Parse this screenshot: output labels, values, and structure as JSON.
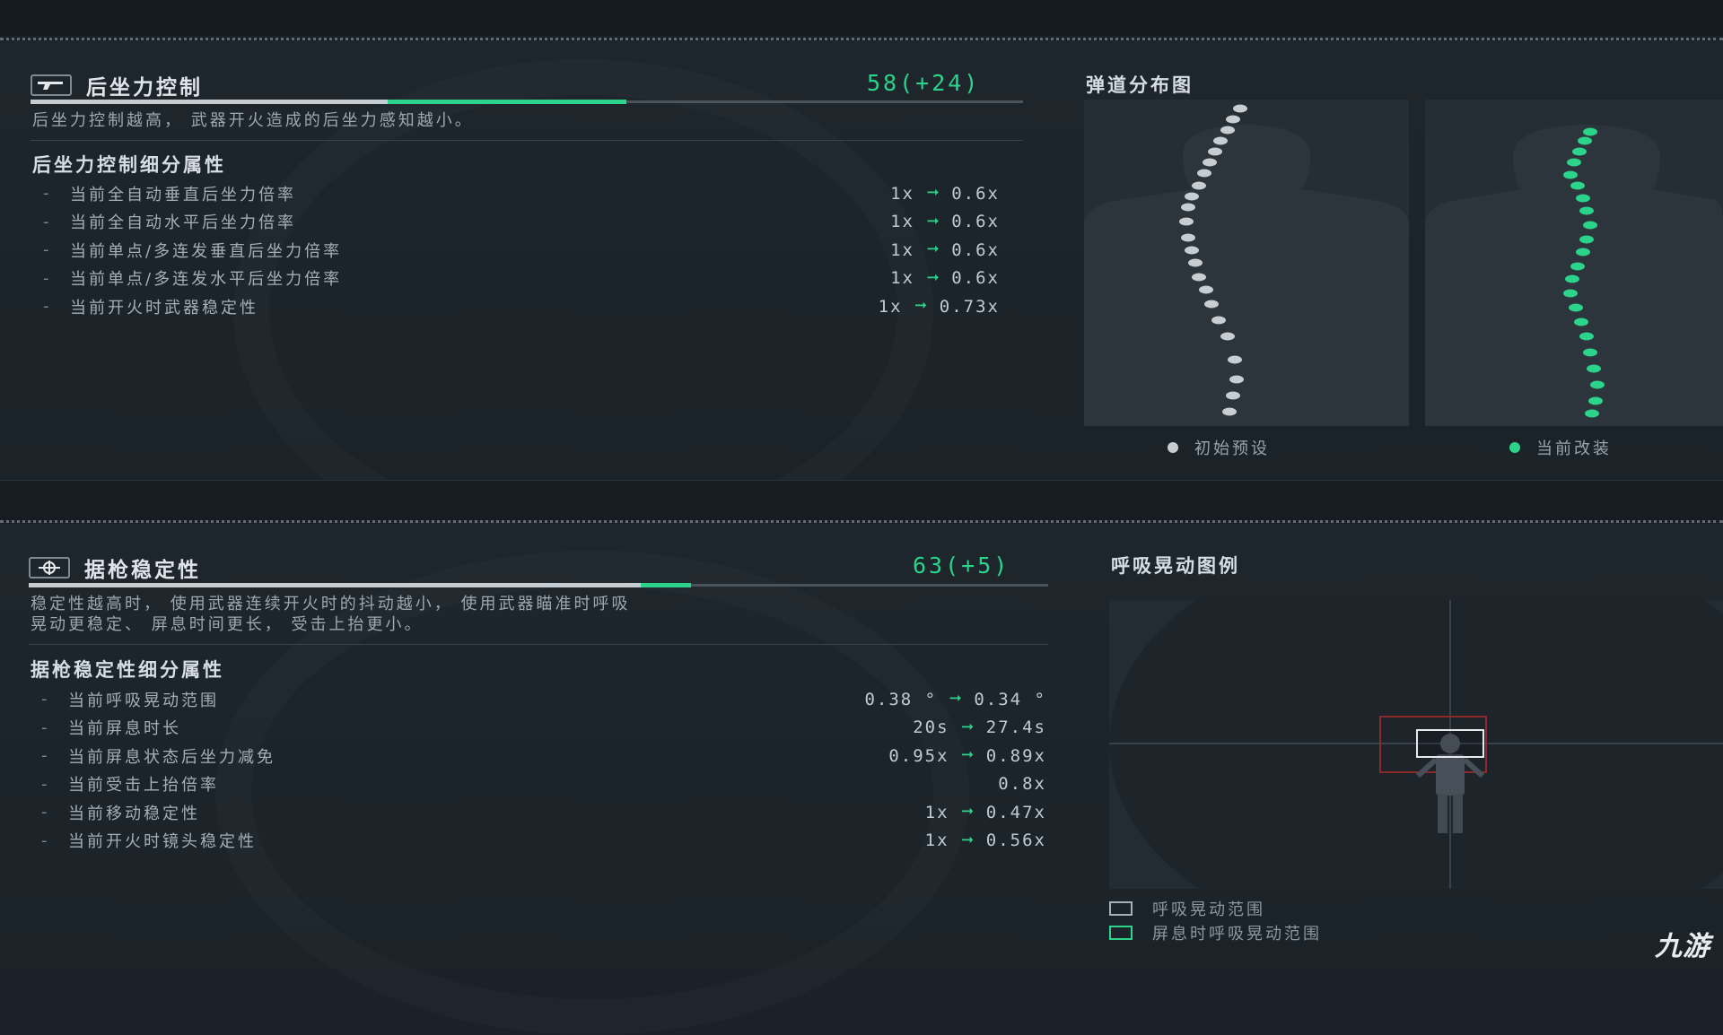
{
  "recoil": {
    "title": "后坐力控制",
    "score": "58(+24)",
    "base_level": 0.36,
    "bonus_level": 0.24,
    "description": "后坐力控制越高， 武器开火造成的后坐力感知越小。",
    "subtitle": "后坐力控制细分属性",
    "rows": [
      {
        "label": "当前全自动垂直后坐力倍率",
        "from": "1x",
        "to": "0.6x"
      },
      {
        "label": "当前全自动水平后坐力倍率",
        "from": "1x",
        "to": "0.6x"
      },
      {
        "label": "当前单点/多连发垂直后坐力倍率",
        "from": "1x",
        "to": "0.6x"
      },
      {
        "label": "当前单点/多连发水平后坐力倍率",
        "from": "1x",
        "to": "0.6x"
      },
      {
        "label": "当前开火时武器稳定性",
        "from": "1x",
        "to": "0.73x"
      }
    ]
  },
  "ballistic": {
    "title": "弹道分布图",
    "legend_default": "初始预设",
    "legend_current": "当前改装"
  },
  "stability": {
    "title": "据枪稳定性",
    "score": "63(+5)",
    "base_level": 0.6,
    "bonus_level": 0.05,
    "description_line1": "稳定性越高时， 使用武器连续开火时的抖动越小， 使用武器瞄准时呼吸",
    "description_line2": "晃动更稳定、 屏息时间更长， 受击上抬更小。",
    "subtitle": "据枪稳定性细分属性",
    "rows": [
      {
        "label": "当前呼吸晃动范围",
        "from": "0.38 °",
        "to": "0.34 °"
      },
      {
        "label": "当前屏息时长",
        "from": "20s",
        "to": "27.4s"
      },
      {
        "label": "当前屏息状态后坐力减免",
        "from": "0.95x",
        "to": "0.89x"
      },
      {
        "label": "当前受击上抬倍率",
        "from": "",
        "to": "0.8x"
      },
      {
        "label": "当前移动稳定性",
        "from": "1x",
        "to": "0.47x"
      },
      {
        "label": "当前开火时镜头稳定性",
        "from": "1x",
        "to": "0.56x"
      }
    ]
  },
  "sway": {
    "title": "呼吸晃动图例",
    "legend_1": "呼吸晃动范围",
    "legend_2": "屏息时呼吸晃动范围"
  },
  "watermark": "九游",
  "colors": {
    "accent": "#2bd48a",
    "default_dot": "#c8cdd1",
    "bar_base": "#c5ccd2",
    "red_box": "#8a2a2a"
  },
  "icons": {
    "recoil": "pistol-icon",
    "stability": "crosshair-icon"
  }
}
